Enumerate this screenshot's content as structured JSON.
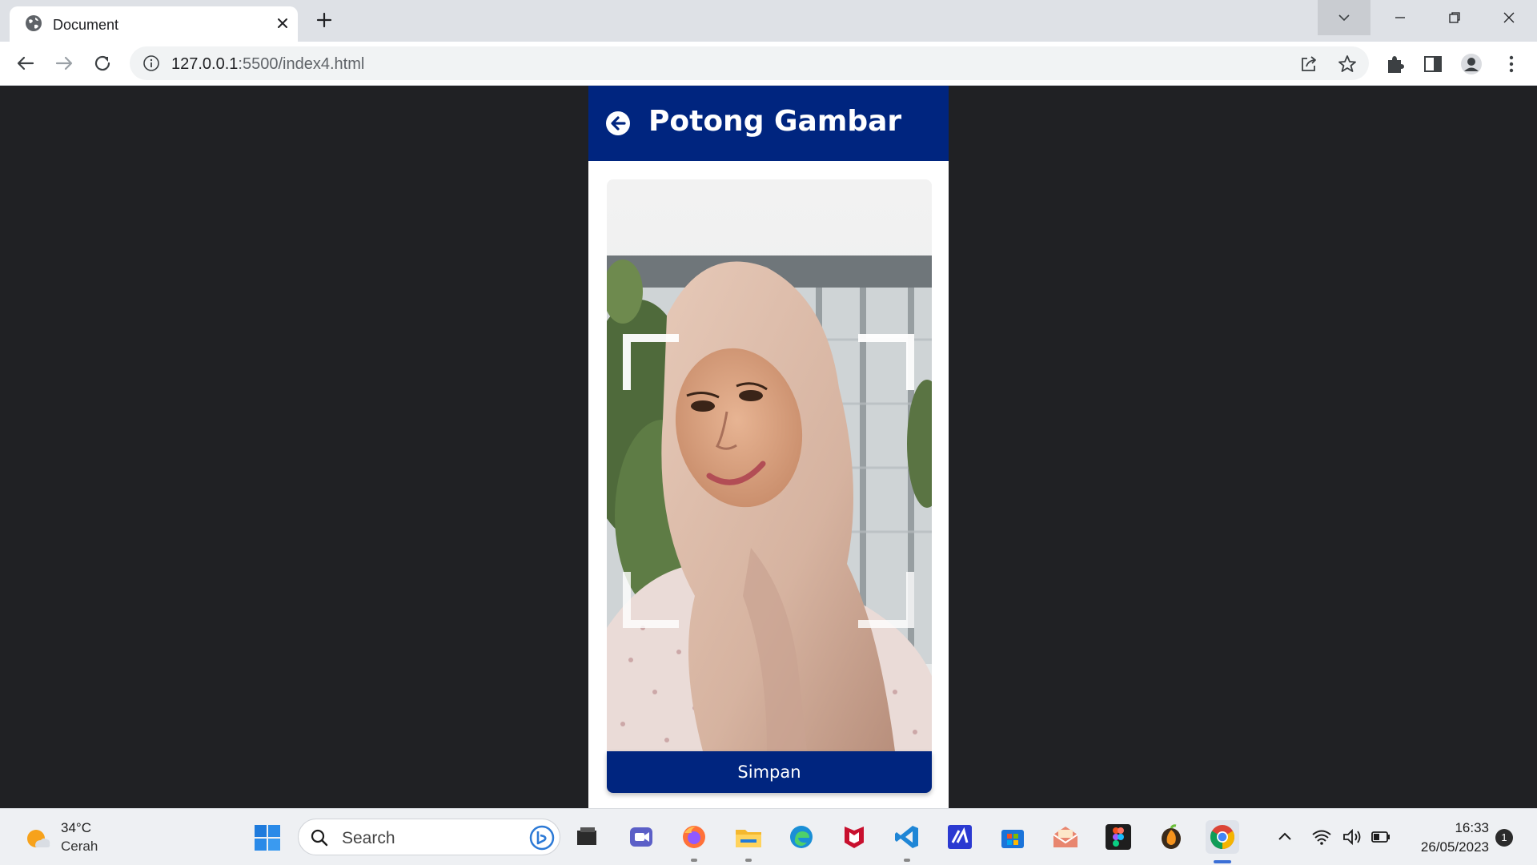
{
  "browser": {
    "tab": {
      "title": "Document"
    },
    "address": {
      "host": "127.0.0.1",
      "path": ":5500/index4.html"
    }
  },
  "app": {
    "header": {
      "title": "Potong Gambar"
    },
    "save_label": "Simpan",
    "colors": {
      "primary": "#00257f",
      "surface": "#ffffff",
      "backdrop": "#202124"
    }
  },
  "taskbar": {
    "weather": {
      "temp": "34°C",
      "condition": "Cerah"
    },
    "search_placeholder": "Search",
    "clock": {
      "time": "16:33",
      "date": "26/05/2023"
    },
    "notification_count": "1",
    "apps": [
      "file-explorer-dark-icon",
      "teams-icon",
      "firefox-icon",
      "file-explorer-icon",
      "edge-icon",
      "mcafee-icon",
      "vscode-icon",
      "ide-icon",
      "microsoft-store-icon",
      "mail-icon",
      "figma-icon",
      "fl-studio-icon",
      "chrome-icon"
    ]
  }
}
